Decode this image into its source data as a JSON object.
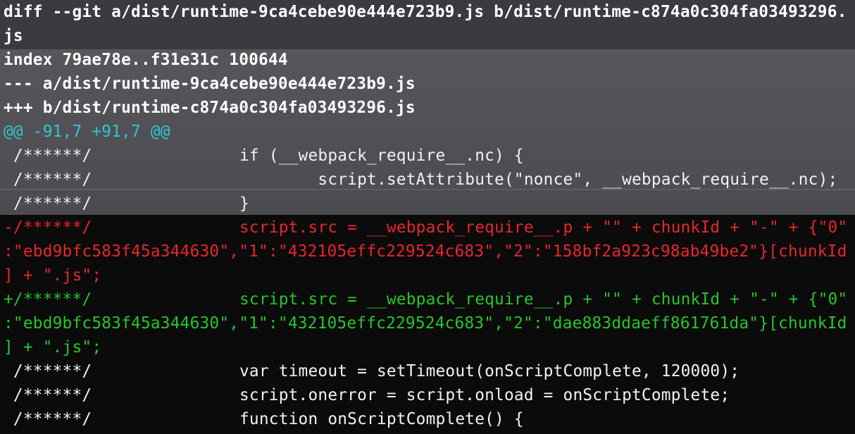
{
  "diff": {
    "header": {
      "git_line": "diff --git a/dist/runtime-9ca4cebe90e444e723b9.js b/dist/runtime-c874a0c304fa03493296.",
      "git_line_wrap": "js",
      "index_line": "index 79ae78e..f31e31c 100644",
      "old_file": "--- a/dist/runtime-9ca4cebe90e444e723b9.js",
      "new_file": "+++ b/dist/runtime-c874a0c304fa03493296.js"
    },
    "hunk_header": "@@ -91,7 +91,7 @@",
    "lines": [
      {
        "type": "ctx",
        "prefix": " /******/",
        "code": "if (__webpack_require__.nc) {"
      },
      {
        "type": "ctx",
        "prefix": " /******/",
        "code": "        script.setAttribute(\"nonce\", __webpack_require__.nc);"
      },
      {
        "type": "ctx",
        "prefix": " /******/",
        "code": "}"
      },
      {
        "type": "del",
        "prefix": "-/******/",
        "code": "script.src = __webpack_require__.p + \"\" + chunkId + \"-\" + {\"0\""
      },
      {
        "type": "del",
        "prefix": ":\"ebd9bfc583f45a344630\",\"1\":\"432105effc229524c683\",\"2\":\"158bf2a923c98ab49be2\"}[chunkId",
        "code": ""
      },
      {
        "type": "del",
        "prefix": "] + \".js\";",
        "code": ""
      },
      {
        "type": "add",
        "prefix": "+/******/",
        "code": "script.src = __webpack_require__.p + \"\" + chunkId + \"-\" + {\"0\""
      },
      {
        "type": "add",
        "prefix": ":\"ebd9bfc583f45a344630\",\"1\":\"432105effc229524c683\",\"2\":\"dae883ddaeff861761da\"}[chunkId",
        "code": ""
      },
      {
        "type": "add",
        "prefix": "] + \".js\";",
        "code": ""
      },
      {
        "type": "ctx",
        "prefix": " /******/",
        "code": "var timeout = setTimeout(onScriptComplete, 120000);"
      },
      {
        "type": "ctx",
        "prefix": " /******/",
        "code": "script.onerror = script.onload = onScriptComplete;"
      },
      {
        "type": "ctx",
        "prefix": " /******/",
        "code": "function onScriptComplete() {"
      }
    ]
  },
  "colors": {
    "header": "#ffffff",
    "hunk": "#2fc6cf",
    "context": "#f2f2f2",
    "deleted": "#e8262b",
    "added": "#27c52c"
  }
}
